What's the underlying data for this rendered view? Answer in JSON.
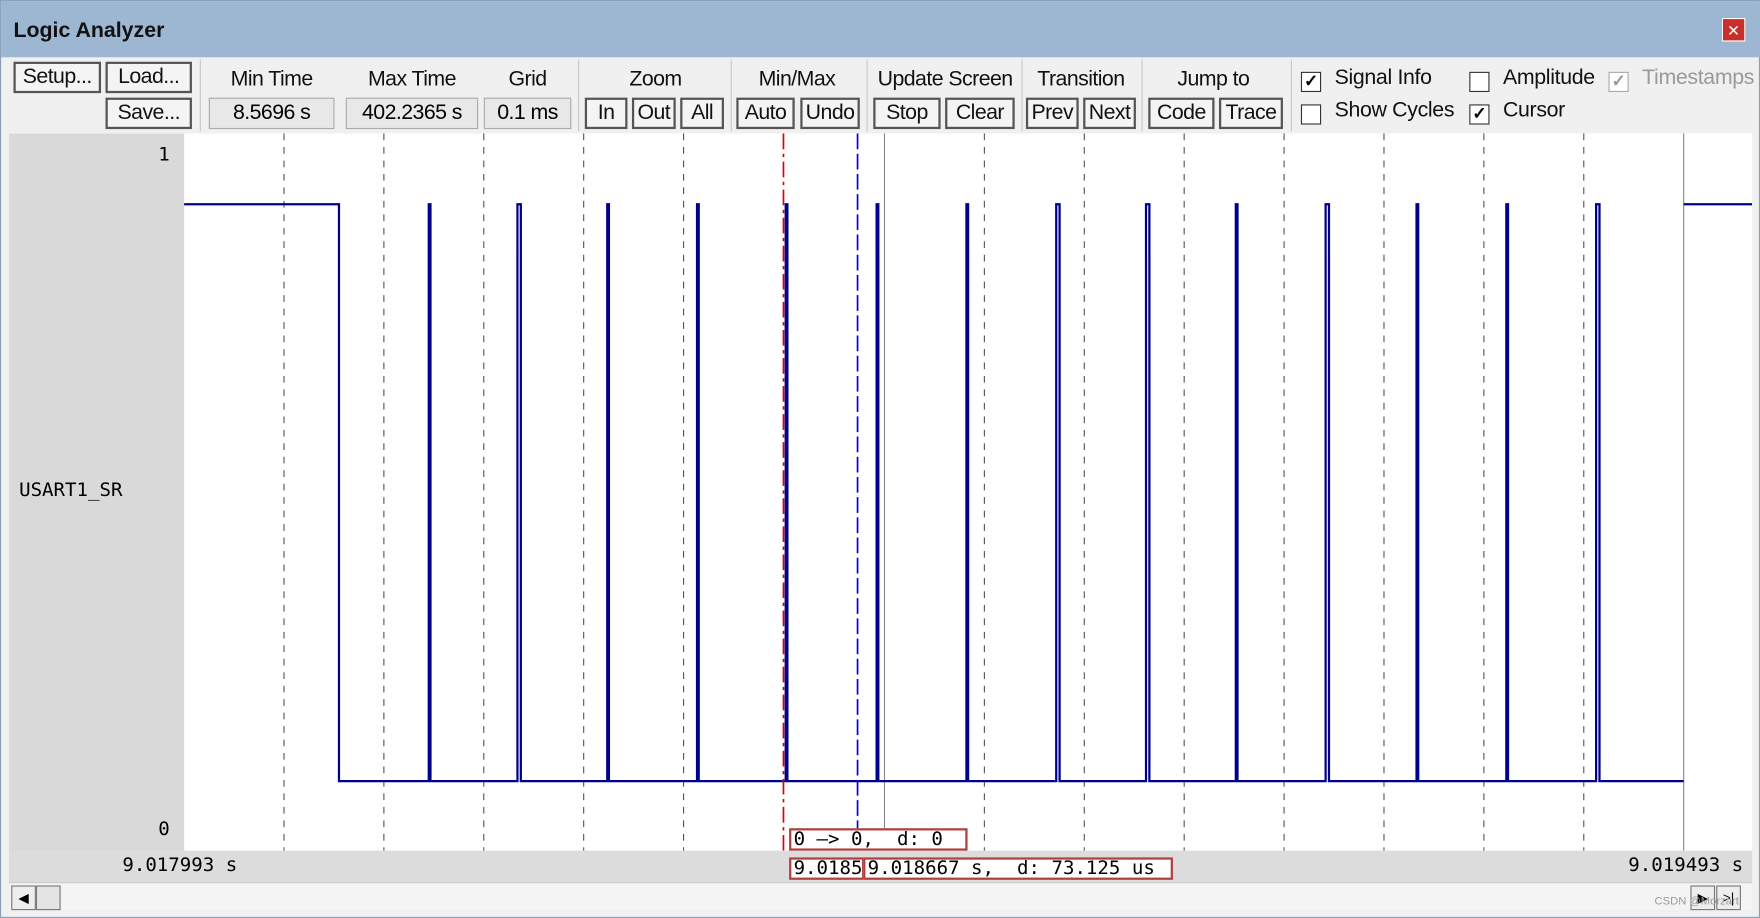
{
  "window": {
    "title": "Logic Analyzer",
    "close_icon": "close-icon"
  },
  "toolbar": {
    "setup": "Setup...",
    "load": "Load...",
    "save": "Save...",
    "min_time_label": "Min Time",
    "min_time": "8.5696 s",
    "max_time_label": "Max Time",
    "max_time": "402.2365 s",
    "grid_label": "Grid",
    "grid": "0.1 ms",
    "zoom_label": "Zoom",
    "zoom_in": "In",
    "zoom_out": "Out",
    "zoom_all": "All",
    "minmax_label": "Min/Max",
    "auto": "Auto",
    "undo": "Undo",
    "update_label": "Update Screen",
    "stop": "Stop",
    "clear": "Clear",
    "transition_label": "Transition",
    "prev": "Prev",
    "next": "Next",
    "jump_label": "Jump to",
    "code": "Code",
    "trace": "Trace",
    "options": [
      {
        "label": "Signal Info",
        "checked": true,
        "enabled": true
      },
      {
        "label": "Amplitude",
        "checked": false,
        "enabled": true
      },
      {
        "label": "Timestamps",
        "checked": true,
        "enabled": false
      },
      {
        "label": "Show Cycles",
        "checked": false,
        "enabled": true
      },
      {
        "label": "Cursor",
        "checked": true,
        "enabled": true
      }
    ]
  },
  "signal": {
    "name": "USART1_SR",
    "max": "1",
    "min": "0",
    "line_color": "#00008b"
  },
  "axis": {
    "start": "9.017993 s",
    "end": "9.019493 s"
  },
  "cursor": {
    "value_box": "0 —> 0,  d: 0",
    "time_box_left": "9.0185",
    "time_box": "9.018667 s,  d: 73.125 us",
    "red": "#e00000",
    "blue": "#0000e0"
  },
  "watermark": "CSDN @Morzart"
}
